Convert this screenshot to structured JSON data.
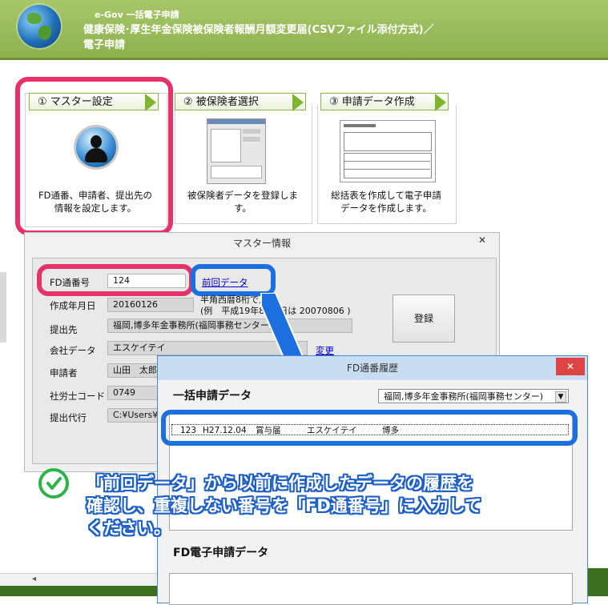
{
  "header": {
    "app_name": "e-Gov 一括電子申請",
    "title_line1": "健康保険･厚生年金保険被保険者報酬月額変更届(CSVファイル添付方式)／",
    "title_line2": "電子申請"
  },
  "steps": [
    {
      "label": "① マスター設定",
      "desc_line1": "FD通番、申請者、提出先の",
      "desc_line2": "情報を設定します。"
    },
    {
      "label": "② 被保険者選択",
      "desc_line1": "被保険者データを登録しま",
      "desc_line2": "す。"
    },
    {
      "label": "③ 申請データ作成",
      "desc_line1": "総括表を作成して電子申請",
      "desc_line2": "データを作成します。"
    }
  ],
  "master": {
    "title": "マスター情報",
    "close": "✕",
    "fd_label": "FD通番号",
    "fd_value": "124",
    "prev_link": "前回データ",
    "date_label": "作成年月日",
    "date_value": "20160126",
    "date_hint_line1": "半角西暦8桁で入力",
    "date_hint_line2": "(例　平成19年8月6日は 20070806 )",
    "dest_label": "提出先",
    "dest_value": "福岡,博多年金事務所(福岡事務センター)",
    "company_label": "会社データ",
    "company_value": "エスケイテイ",
    "company_link": "変更",
    "applicant_label": "申請者",
    "applicant_value": "山田　太郎",
    "sharoushi_label": "社労士コード",
    "sharoushi_value": "0749",
    "proxy_label": "提出代行",
    "proxy_value": "C:¥Users¥",
    "register_button": "登録"
  },
  "fd_history": {
    "title": "FD通番履歴",
    "close": "✕",
    "section1": "一括申請データ",
    "dropdown_value": "福岡,博多年金事務所(福岡事務センター)",
    "row": {
      "no": "123",
      "date": "H27.12.04",
      "type": "賞与届",
      "company": "エスケイテイ",
      "office": "博多"
    },
    "section2": "FD電子申請データ"
  },
  "annotation": {
    "line1": "「前回データ」から以前に作成したデータの履歴を",
    "line2": "確認し、重複しない番号を「FD通番号」に入力して",
    "line3": "ください。"
  },
  "colors": {
    "header_green": "#8db24f",
    "highlight_pink": "#e5326b",
    "highlight_blue": "#1d6fe0",
    "check_green": "#2db34a"
  }
}
